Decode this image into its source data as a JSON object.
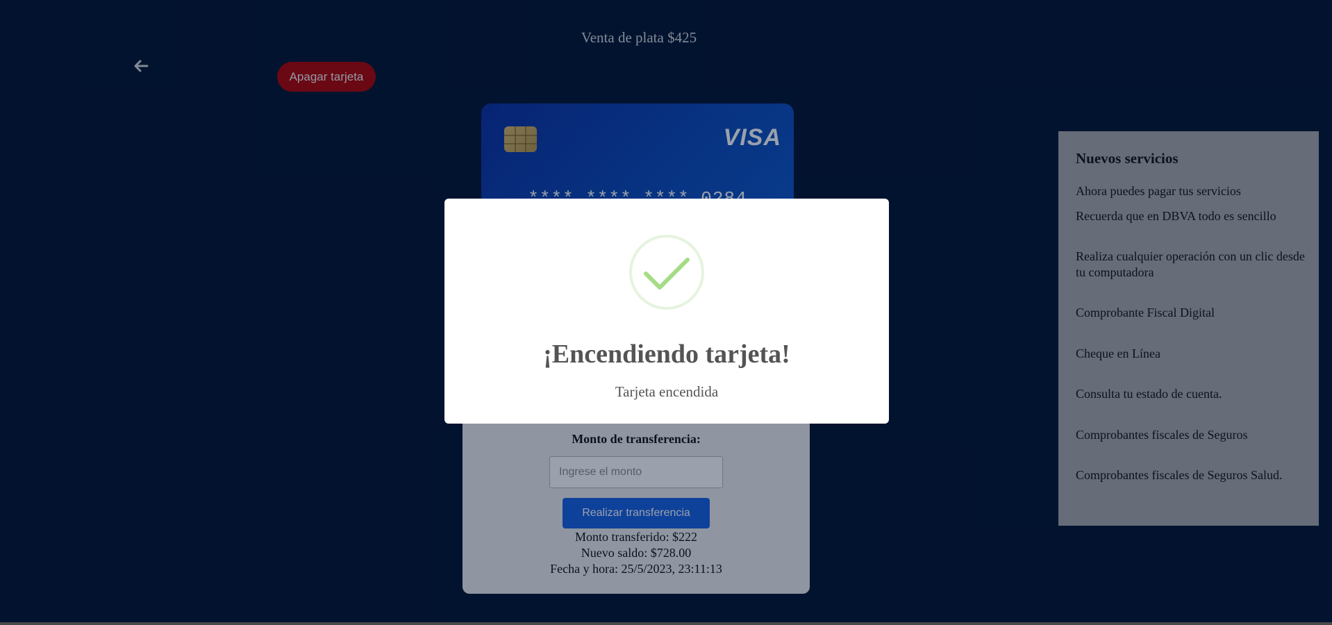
{
  "header": {
    "title": "Venta de plata $425",
    "back_icon": "arrow-left-icon",
    "toggle_card_label": "Apagar tarjeta",
    "toggle_card_color": "#b00000"
  },
  "card": {
    "brand": "VISA",
    "number": "**** **** **** 0284",
    "chip_icon": "card-chip-icon",
    "gradient_colors": [
      "#0a2fa0",
      "#0f56c8"
    ]
  },
  "transfer": {
    "label": "Monto de transferencia:",
    "input_value": "",
    "input_placeholder": "Ingrese el monto",
    "submit_label": "Realizar transferencia",
    "submit_color": "#1760e1",
    "result": {
      "transferred": "Monto transferido: $222",
      "new_balance": "Nuevo saldo: $728.00",
      "datetime": "Fecha y hora: 25/5/2023, 23:11:13"
    }
  },
  "sidebar": {
    "title": "Nuevos servicios",
    "items": [
      {
        "label": "Ahora puedes pagar tus servicios"
      },
      {
        "label": "Recuerda que en DBVA todo es sencillo"
      },
      {
        "label": "Realiza cualquier operación con un clic desde tu computadora"
      },
      {
        "label": "Comprobante Fiscal Digital"
      },
      {
        "label": "Cheque en Línea"
      },
      {
        "label": "Consulta tu estado de cuenta."
      },
      {
        "label": "Comprobantes fiscales de Seguros"
      },
      {
        "label": "Comprobantes fiscales de Seguros Salud."
      }
    ]
  },
  "modal": {
    "icon": "check-circle-icon",
    "icon_color": "#a5dc86",
    "title": "¡Encendiendo tarjeta!",
    "text": "Tarjeta encendida"
  },
  "colors": {
    "background": "#03132f",
    "sidebar_bg": "#a9a9a9",
    "panel_bg": "#ededed"
  }
}
